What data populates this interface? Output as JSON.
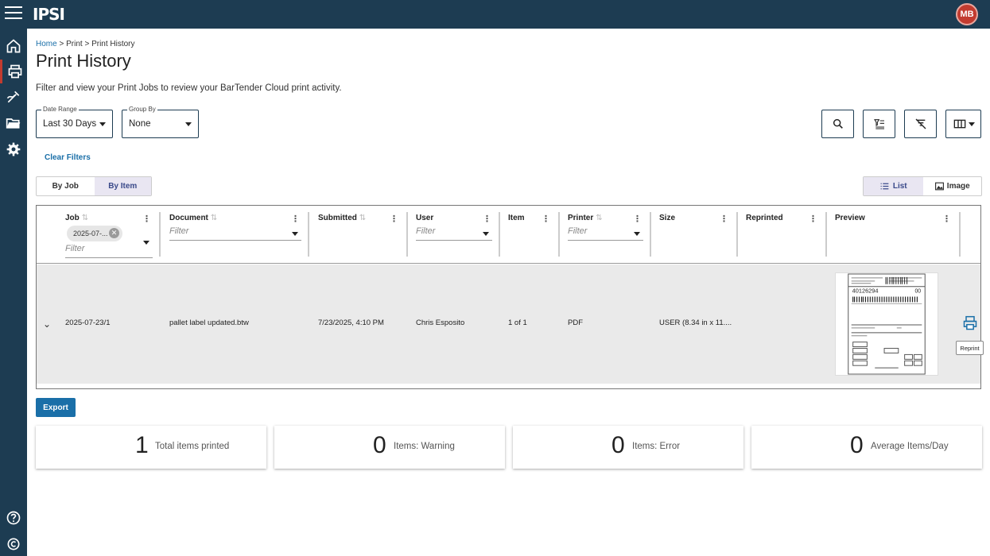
{
  "app": {
    "logo_text": "IPSI",
    "user_initials": "MB"
  },
  "sidebar": {
    "items": [
      {
        "icon": "home-icon"
      },
      {
        "icon": "printer-icon"
      },
      {
        "icon": "label-design-icon"
      },
      {
        "icon": "folder-icon"
      },
      {
        "icon": "settings-icon"
      }
    ]
  },
  "breadcrumb": {
    "home": "Home",
    "sep1": ">",
    "print": "Print",
    "sep2": ">",
    "current": "Print History"
  },
  "page": {
    "title": "Print History",
    "subtitle": "Filter and view your Print Jobs to review your BarTender Cloud print activity."
  },
  "filters": {
    "date_range": {
      "label": "Date Range",
      "value": "Last 30 Days"
    },
    "group_by": {
      "label": "Group By",
      "value": "None"
    },
    "clear_label": "Clear Filters"
  },
  "view_toggle": {
    "by_job": "By Job",
    "by_item": "By Item",
    "selected": "By Item"
  },
  "display_toggle": {
    "list": "List",
    "image": "Image",
    "selected": "List"
  },
  "grid": {
    "columns": [
      {
        "label": "Job"
      },
      {
        "label": "Document"
      },
      {
        "label": "Submitted"
      },
      {
        "label": "User"
      },
      {
        "label": "Item"
      },
      {
        "label": "Printer"
      },
      {
        "label": "Size"
      },
      {
        "label": "Reprinted"
      },
      {
        "label": "Preview"
      }
    ],
    "filter_placeholder": "Filter",
    "job_chip": "2025-07-...",
    "row": {
      "job": "2025-07-23/1",
      "document": "pallet label updated.btw",
      "submitted": "7/23/2025, 4:10 PM",
      "user": "Chris Esposito",
      "item": "1 of 1",
      "printer": "PDF",
      "size": "USER (8.34 in x 11....",
      "preview_barcode1": "40126294",
      "preview_num": "00"
    },
    "reprint_tooltip": "Reprint"
  },
  "export_label": "Export",
  "stats": [
    {
      "value": "1",
      "label": "Total items printed"
    },
    {
      "value": "0",
      "label": "Items: Warning"
    },
    {
      "value": "0",
      "label": "Items: Error"
    },
    {
      "value": "0",
      "label": "Average Items/Day"
    }
  ],
  "colors": {
    "nav": "#1d3c52",
    "accent": "#1a6fa8",
    "avatar": "#c23b2f"
  }
}
